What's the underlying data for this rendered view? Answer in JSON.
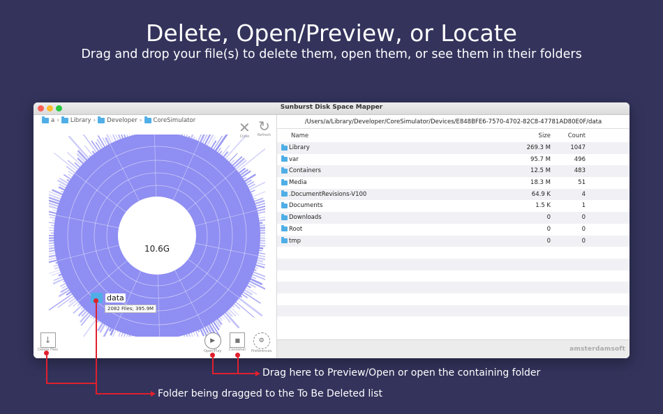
{
  "headline": "Delete, Open/Preview, or Locate",
  "subheadline": "Drag and drop your file(s) to delete them, open them, or see them in their folders",
  "window": {
    "title": "Sunburst Disk Space Mapper",
    "breadcrumb": [
      "a",
      "Library",
      "Developer",
      "CoreSimulator"
    ],
    "close_label": "Close",
    "refresh_label": "Refresh",
    "center_value": "10.6G",
    "drag": {
      "name": "data",
      "info": "2082 Files; 395.9M"
    },
    "bottom_tools": {
      "delete_files": "Delete Files",
      "open_play": "Open/Play",
      "container": "Container",
      "preferences": "Preferences"
    },
    "path": "/Users/a/Library/Developer/CoreSimulator/Devices/E848BFE6-7570-4702-82C8-47781AD80E0F/data",
    "table": {
      "headers": {
        "name": "Name",
        "size": "Size",
        "count": "Count"
      },
      "rows": [
        {
          "name": "Library",
          "size": "269.3 M",
          "count": "1047"
        },
        {
          "name": "var",
          "size": "95.7 M",
          "count": "496"
        },
        {
          "name": "Containers",
          "size": "12.5 M",
          "count": "483"
        },
        {
          "name": "Media",
          "size": "18.3 M",
          "count": "51"
        },
        {
          "name": ".DocumentRevisions-V100",
          "size": "64.9 K",
          "count": "4"
        },
        {
          "name": "Documents",
          "size": "1.5 K",
          "count": "1"
        },
        {
          "name": "Downloads",
          "size": "0",
          "count": "0"
        },
        {
          "name": "Root",
          "size": "0",
          "count": "0"
        },
        {
          "name": "tmp",
          "size": "0",
          "count": "0"
        }
      ]
    },
    "brand": "amsterdamsoft"
  },
  "annotations": {
    "preview": "Drag here to Preview/Open or open the containing folder",
    "delete": "Folder being dragged to the To Be Deleted list"
  },
  "colors": {
    "background": "#33335c",
    "sunburst": "#8f8ef2",
    "annotation": "#e0202e",
    "folder": "#4faee6"
  }
}
